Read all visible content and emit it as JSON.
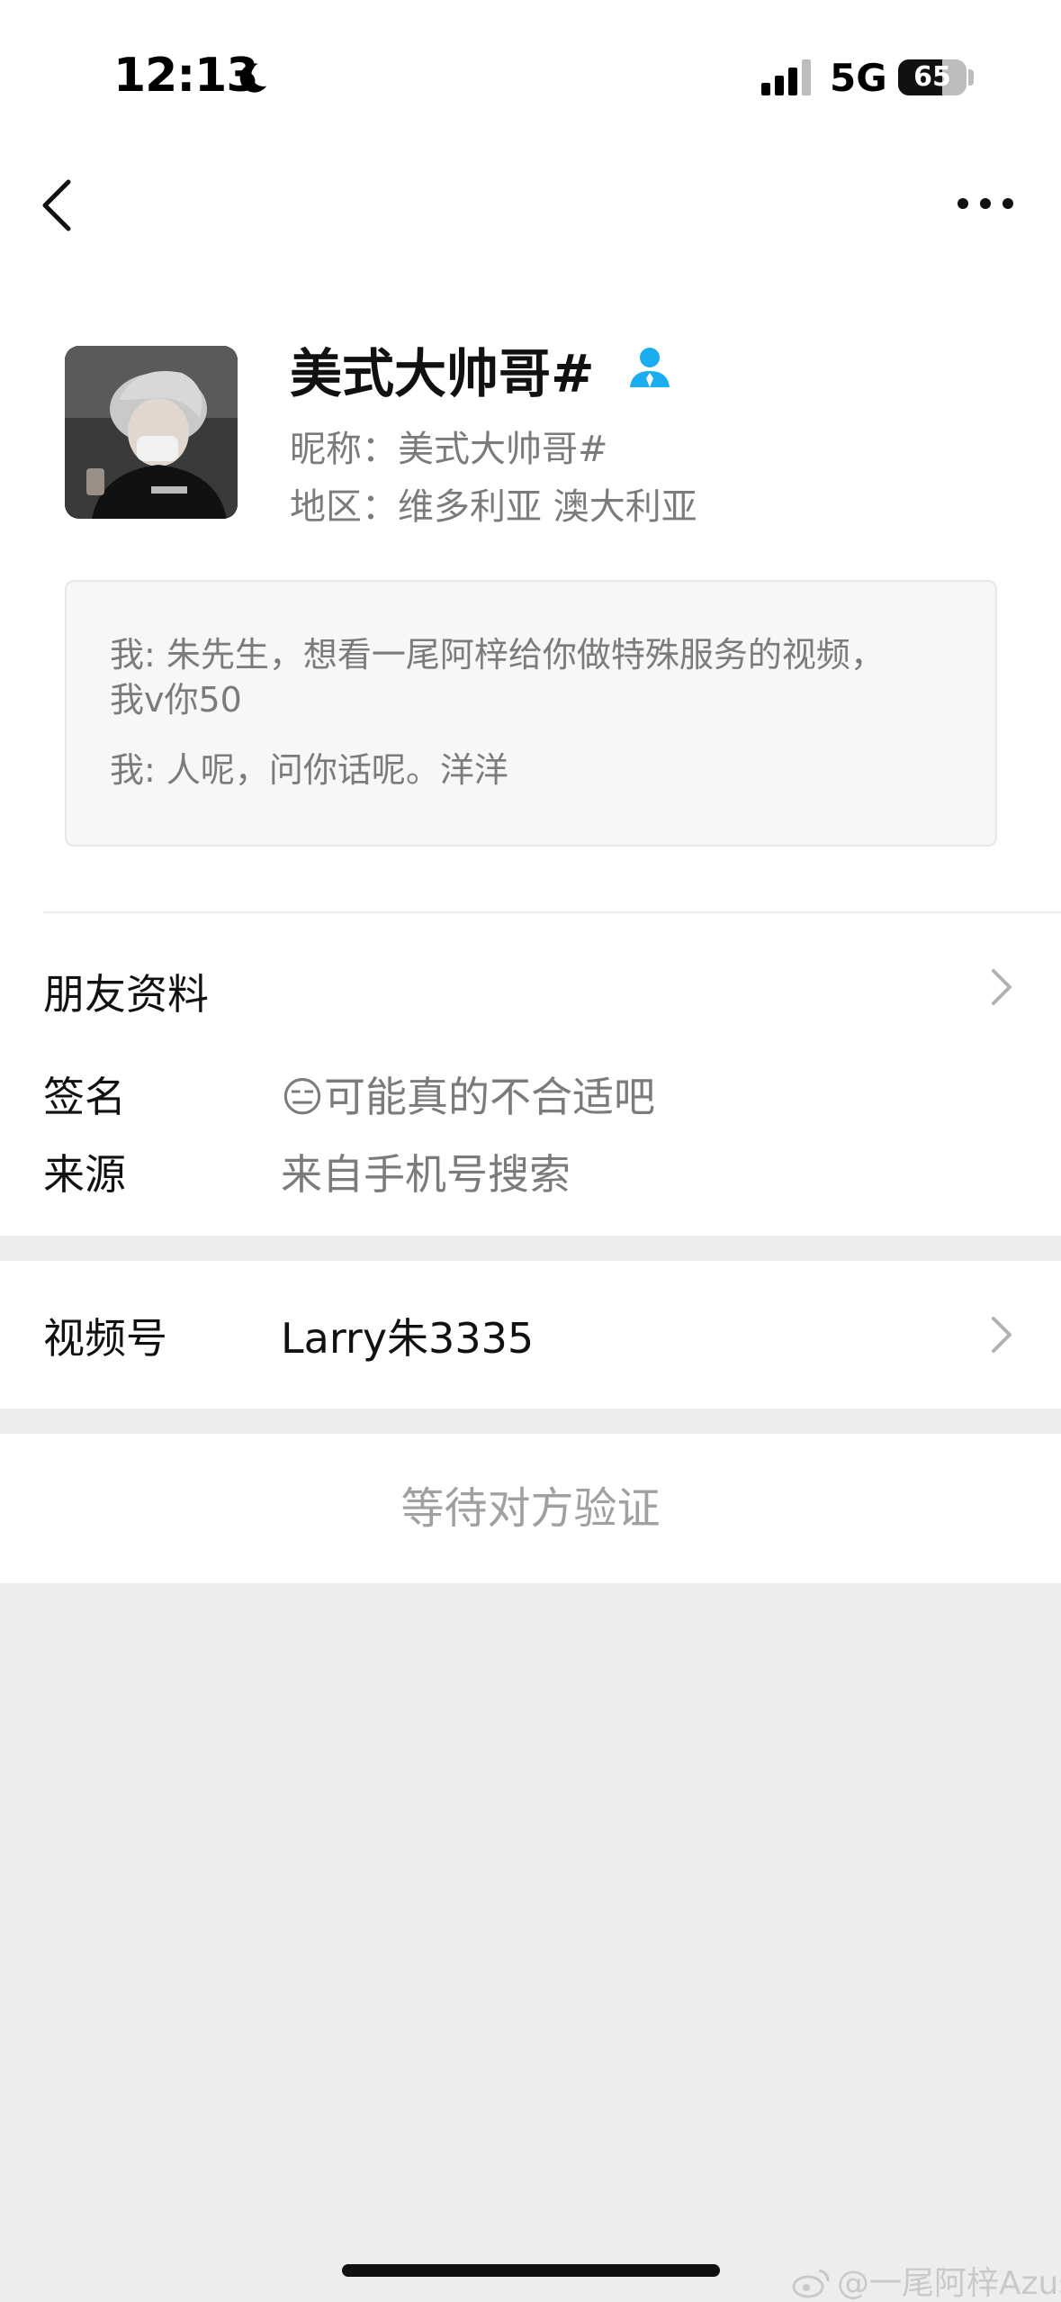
{
  "status_bar": {
    "time": "12:13",
    "network": "5G",
    "battery": "65",
    "battery_level": 0.65
  },
  "profile": {
    "display_name": "美式大帅哥#",
    "nickname": "昵称：美式大帅哥#",
    "region": "地区：维多利亚 澳大利亚"
  },
  "messages": [
    "我: 朱先生，想看一尾阿梓给你做特殊服务的视频，我v你50",
    "我: 人呢，问你话呢。洋洋"
  ],
  "info": {
    "friend_profile": "朋友资料",
    "signature_label": "签名",
    "signature_emoji": "😑",
    "signature_value": "可能真的不合适吧",
    "source_label": "来源",
    "source_value": "来自手机号搜索"
  },
  "channels": {
    "label": "视频号",
    "value": "Larry朱3335"
  },
  "action": {
    "waiting": "等待对方验证"
  },
  "watermark": "@一尾阿梓Azusa",
  "colors": {
    "accent_blue": "#1aadf0",
    "muted_text": "#7b7b7b",
    "page_bg": "#ededed"
  }
}
